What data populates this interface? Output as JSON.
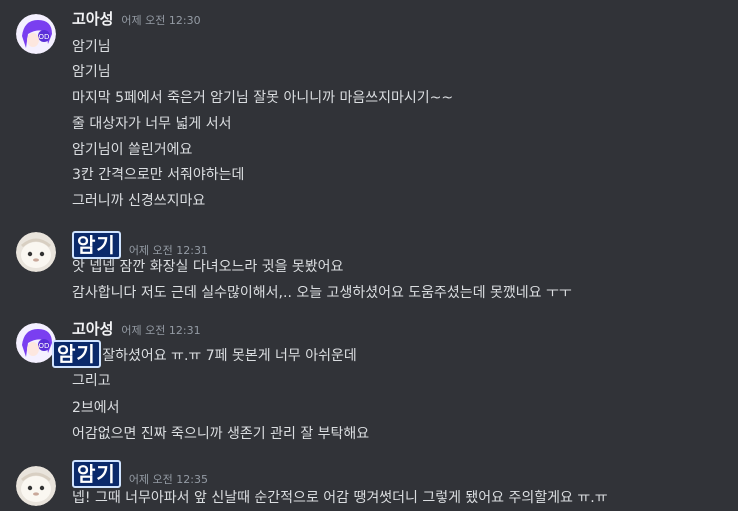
{
  "messages": [
    {
      "username": "고아성",
      "timestamp": "어제 오전 12:30",
      "lines": [
        "암기님",
        "암기님",
        "마지막 5페에서 죽은거 암기님 잘못 아니니까 마음쓰지마시기~~",
        "줄 대상자가 너무 넓게 서서",
        "암기님이 쓸린거에요",
        "3칸 간격으로만 서줘야하는데",
        "그러니까 신경쓰지마요"
      ]
    },
    {
      "username": "암기",
      "timestamp": "어제 오전 12:31",
      "lines": [
        "앗 넵넵 잠깐 화장실 다녀오느라 귓을 못봤어요",
        "감사합니다 저도 근데 실수많이해서,.. 오늘 고생하셨어요 도움주셨는데 못깼네요 ㅜㅜ"
      ]
    },
    {
      "username": "고아성",
      "timestamp": "어제 오전 12:31",
      "lines": [
        "님도 잘하셨어요 ㅠ.ㅠ 7페 못본게 너무 아쉬운데",
        "그리고",
        "2브에서",
        "어감없으면 진짜 죽으니까 생존기 관리 잘 부탁해요"
      ],
      "overlay_name": "암기"
    },
    {
      "username": "암기",
      "timestamp": "어제 오전 12:35",
      "lines": [
        "넵! 그때 너무아파서 앞 신날때 순간적으로 어감 땡겨썻더니 그렇게 됐어요 주의할게요 ㅠ.ㅠ"
      ]
    }
  ],
  "colors": {
    "background": "#313338",
    "text": "#dbdee1",
    "username": "#f2f3f5",
    "timestamp": "#949ba4",
    "sticker_bg": "#0b2a6b"
  },
  "icons": {
    "avatar_1": "purple-hair-character-avatar",
    "avatar_2": "white-fluffy-creature-avatar"
  }
}
